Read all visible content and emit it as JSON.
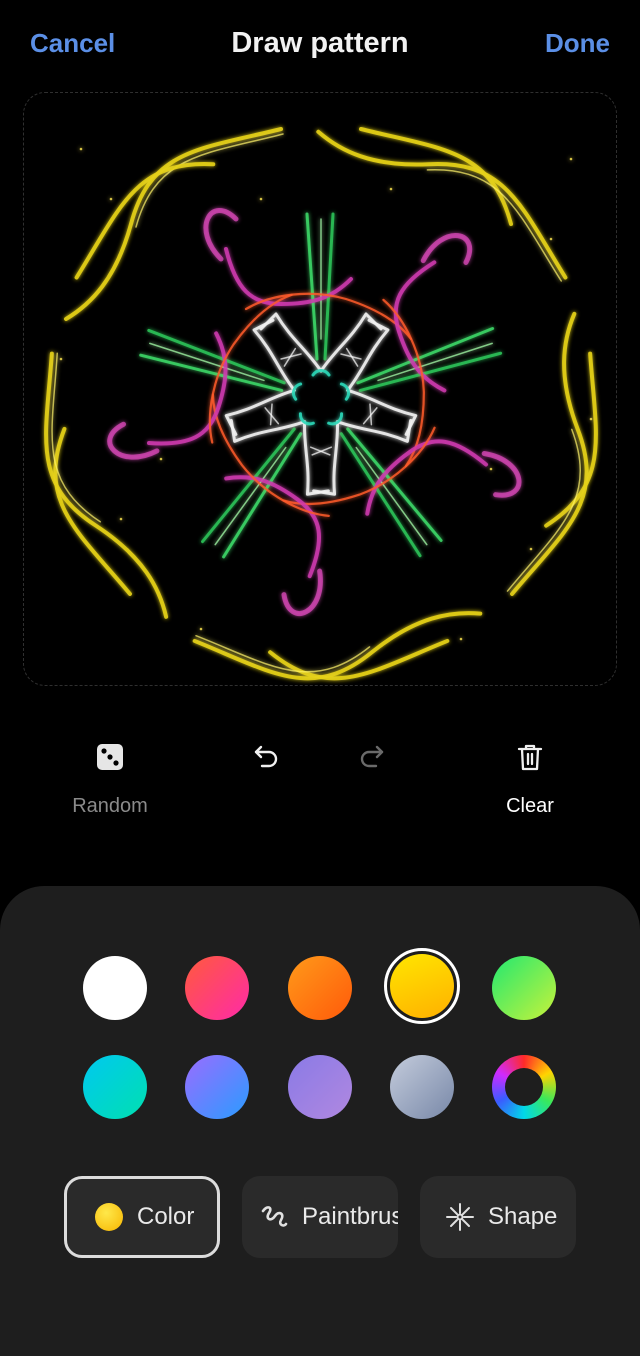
{
  "header": {
    "cancel_label": "Cancel",
    "title": "Draw pattern",
    "done_label": "Done"
  },
  "tools": {
    "random_label": "Random",
    "clear_label": "Clear",
    "undo_icon": "undo-icon",
    "redo_icon": "redo-icon",
    "random_icon": "dice-icon",
    "clear_icon": "trash-icon"
  },
  "palette": {
    "selected": "yellow",
    "colors": [
      {
        "name": "white",
        "color": "#ffffff"
      },
      {
        "name": "red-pink",
        "color": "#ff2a8a"
      },
      {
        "name": "orange",
        "color": "#ff7a1a"
      },
      {
        "name": "yellow",
        "color": "#ffd400"
      },
      {
        "name": "green",
        "color": "#52e85a"
      },
      {
        "name": "cyan",
        "color": "#00d8d8"
      },
      {
        "name": "blue-violet",
        "color": "#5f7cff"
      },
      {
        "name": "lavender",
        "color": "#9a80de"
      },
      {
        "name": "gray-blue",
        "color": "#9aa6c0"
      },
      {
        "name": "custom",
        "color": "color-wheel"
      }
    ]
  },
  "modes": {
    "color_label": "Color",
    "paintbrush_label": "Paintbrush",
    "shape_label": "Shape"
  },
  "colors": {
    "accent": "#5b8fe6",
    "background": "#000000",
    "panel": "#1e1e1e",
    "button": "#2a2a2a"
  }
}
